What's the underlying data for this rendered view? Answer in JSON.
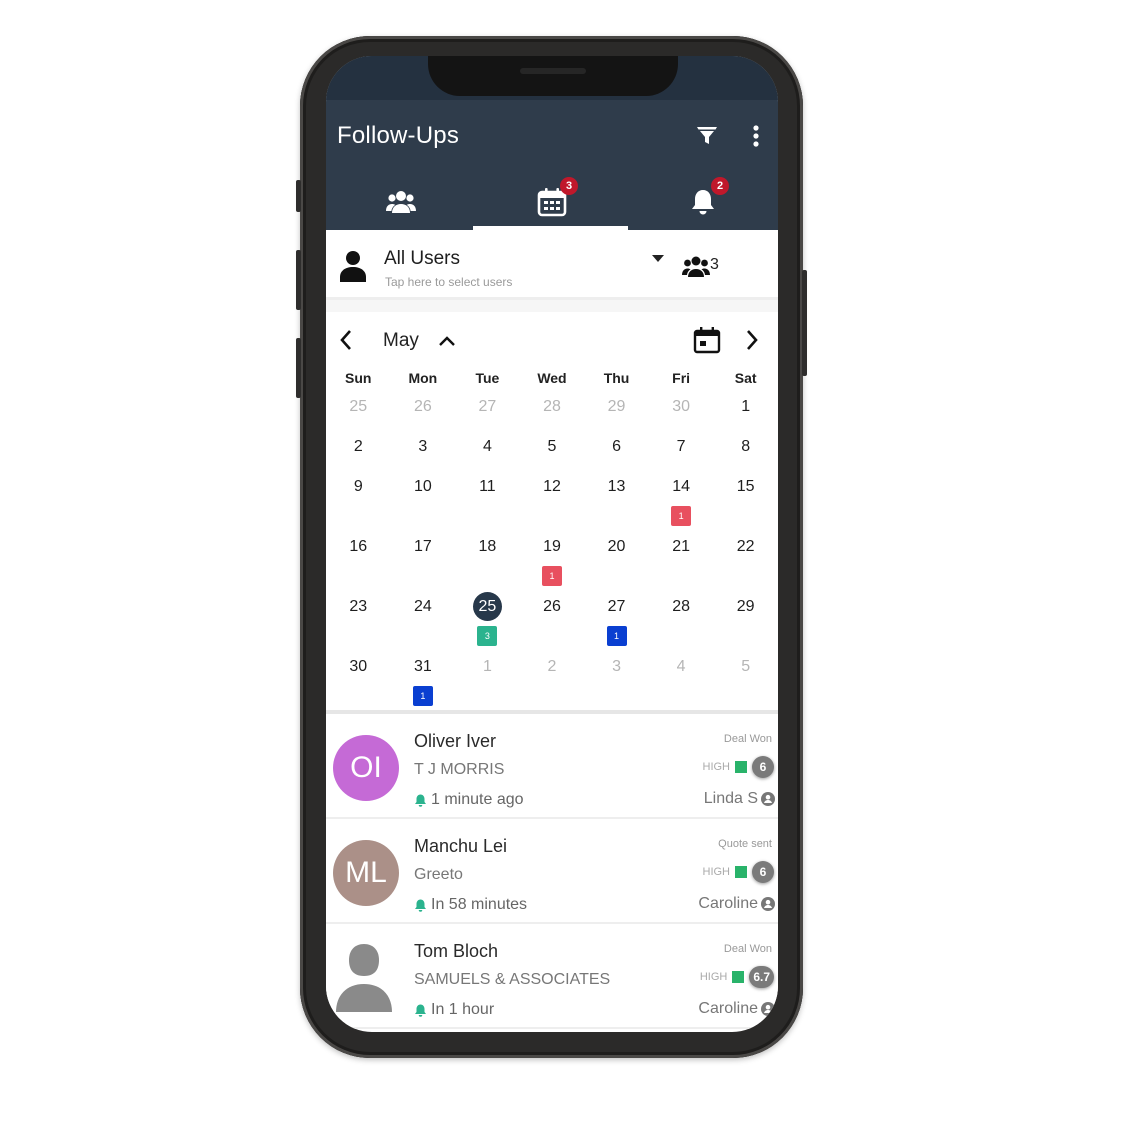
{
  "app": {
    "title": "Follow-Ups",
    "icons": {
      "filter": "filter-funnel-icon",
      "more": "more-vertical-icon"
    }
  },
  "tabs": [
    {
      "name": "contacts",
      "icon": "group-icon",
      "badge": null,
      "active": false
    },
    {
      "name": "calendar",
      "icon": "calendar-icon",
      "badge": "3",
      "active": true
    },
    {
      "name": "notifications",
      "icon": "bell-icon",
      "badge": "2",
      "active": false
    }
  ],
  "user_selector": {
    "title": "All Users",
    "subtitle": "Tap here to select users",
    "user_count": "3"
  },
  "calendar": {
    "month": "May",
    "weekdays": [
      "Sun",
      "Mon",
      "Tue",
      "Wed",
      "Thu",
      "Fri",
      "Sat"
    ],
    "weeks": [
      [
        {
          "d": "25",
          "other": true
        },
        {
          "d": "26",
          "other": true
        },
        {
          "d": "27",
          "other": true
        },
        {
          "d": "28",
          "other": true
        },
        {
          "d": "29",
          "other": true
        },
        {
          "d": "30",
          "other": true
        },
        {
          "d": "1"
        }
      ],
      [
        {
          "d": "2"
        },
        {
          "d": "3"
        },
        {
          "d": "4"
        },
        {
          "d": "5"
        },
        {
          "d": "6"
        },
        {
          "d": "7"
        },
        {
          "d": "8"
        }
      ],
      [
        {
          "d": "9"
        },
        {
          "d": "10"
        },
        {
          "d": "11"
        },
        {
          "d": "12"
        },
        {
          "d": "13"
        },
        {
          "d": "14",
          "ev": "1",
          "evColor": "#e8505f"
        },
        {
          "d": "15"
        }
      ],
      [
        {
          "d": "16"
        },
        {
          "d": "17"
        },
        {
          "d": "18"
        },
        {
          "d": "19",
          "ev": "1",
          "evColor": "#e8505f"
        },
        {
          "d": "20"
        },
        {
          "d": "21"
        },
        {
          "d": "22"
        }
      ],
      [
        {
          "d": "23"
        },
        {
          "d": "24"
        },
        {
          "d": "25",
          "selected": true,
          "ev": "3",
          "evColor": "#2bb38e"
        },
        {
          "d": "26"
        },
        {
          "d": "27",
          "ev": "1",
          "evColor": "#0a3fd1"
        },
        {
          "d": "28"
        },
        {
          "d": "29"
        }
      ],
      [
        {
          "d": "30"
        },
        {
          "d": "31",
          "ev": "1",
          "evColor": "#0a3fd1"
        },
        {
          "d": "1",
          "other": true
        },
        {
          "d": "2",
          "other": true
        },
        {
          "d": "3",
          "other": true
        },
        {
          "d": "4",
          "other": true
        },
        {
          "d": "5",
          "other": true
        }
      ]
    ]
  },
  "followups": [
    {
      "initials": "OI",
      "avatar_color": "#c56ad6",
      "name": "Oliver Iver",
      "company": "T J MORRIS",
      "time": "1 minute ago",
      "status": "Deal Won",
      "priority": "HIGH",
      "score": "6",
      "owner": "Linda S"
    },
    {
      "initials": "ML",
      "avatar_color": "#ab9088",
      "name": "Manchu Lei",
      "company": "Greeto",
      "time": "In 58 minutes",
      "status": "Quote sent",
      "priority": "HIGH",
      "score": "6",
      "owner": "Caroline"
    },
    {
      "initials": "",
      "avatar_color": null,
      "name": "Tom Bloch",
      "company": "SAMUELS & ASSOCIATES",
      "time": "In 1 hour",
      "status": "Deal Won",
      "priority": "HIGH",
      "score": "6.7",
      "owner": "Caroline"
    }
  ],
  "colors": {
    "appbar": "#2f3c4b",
    "badge": "#c0182b",
    "selected_day": "#27384a",
    "priority_high": "#29b36a",
    "reminder_bell": "#2bb38e"
  }
}
